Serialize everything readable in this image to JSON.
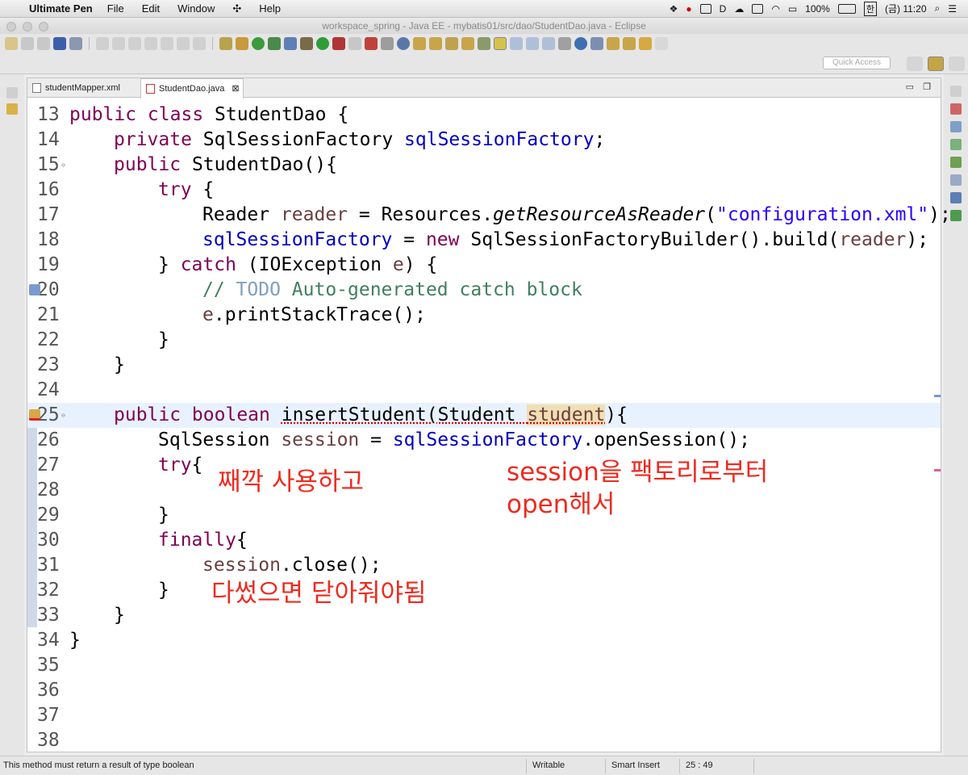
{
  "menubar": {
    "app_name": "Ultimate Pen",
    "items": [
      "File",
      "Edit",
      "Window",
      "Help"
    ],
    "battery": "100%",
    "input_method": "한",
    "clock": "(금) 11:20"
  },
  "window": {
    "title": "workspace_spring - Java EE - mybatis01/src/dao/StudentDao.java - Eclipse"
  },
  "toolbar": {
    "quick_access_placeholder": "Quick Access"
  },
  "editor": {
    "tabs": [
      {
        "label": "studentMapper.xml",
        "active": false
      },
      {
        "label": "StudentDao.java",
        "active": true,
        "close": "⊠"
      }
    ],
    "highlighted_line": "25",
    "lines": [
      {
        "n": "13",
        "marker": ""
      },
      {
        "n": "14",
        "marker": ""
      },
      {
        "n": "15",
        "marker": "fold"
      },
      {
        "n": "16",
        "marker": ""
      },
      {
        "n": "17",
        "marker": ""
      },
      {
        "n": "18",
        "marker": ""
      },
      {
        "n": "19",
        "marker": ""
      },
      {
        "n": "20",
        "marker": "task"
      },
      {
        "n": "21",
        "marker": ""
      },
      {
        "n": "22",
        "marker": ""
      },
      {
        "n": "23",
        "marker": ""
      },
      {
        "n": "24",
        "marker": ""
      },
      {
        "n": "25",
        "marker": "error"
      },
      {
        "n": "26",
        "marker": ""
      },
      {
        "n": "27",
        "marker": ""
      },
      {
        "n": "28",
        "marker": ""
      },
      {
        "n": "29",
        "marker": ""
      },
      {
        "n": "30",
        "marker": ""
      },
      {
        "n": "31",
        "marker": ""
      },
      {
        "n": "32",
        "marker": ""
      },
      {
        "n": "33",
        "marker": ""
      },
      {
        "n": "34",
        "marker": ""
      },
      {
        "n": "35",
        "marker": ""
      },
      {
        "n": "36",
        "marker": ""
      },
      {
        "n": "37",
        "marker": ""
      },
      {
        "n": "38",
        "marker": ""
      }
    ],
    "code": {
      "l13": {
        "a": "public class ",
        "b": "StudentDao {"
      },
      "l14": {
        "a": "private ",
        "b": "SqlSessionFactory ",
        "c": "sqlSessionFactory",
        "d": ";"
      },
      "l15": {
        "a": "public ",
        "b": "StudentDao(){"
      },
      "l16": {
        "a": "try",
        "b": " {"
      },
      "l17": {
        "a": "Reader ",
        "b": "reader",
        "c": " = Resources.",
        "d": "getResourceAsReader",
        "e": "(",
        "f": "\"configuration.xml\"",
        "g": ");"
      },
      "l18": {
        "a": "sqlSessionFactory",
        "b": " = ",
        "c": "new",
        "d": " SqlSessionFactoryBuilder().build(",
        "e": "reader",
        "f": ");"
      },
      "l19": {
        "a": "} ",
        "b": "catch",
        "c": " (IOException ",
        "d": "e",
        "e": ") {"
      },
      "l20": {
        "a": "// ",
        "b": "TODO",
        "c": " Auto-generated catch block"
      },
      "l21": {
        "a": "e",
        "b": ".printStackTrace();"
      },
      "l22": {
        "a": "}"
      },
      "l23": {
        "a": "}"
      },
      "l25": {
        "a": "public boolean ",
        "b": "insertStudent",
        "c": "(Student ",
        "d": "student",
        "e": "){"
      },
      "l26": {
        "a": "SqlSession ",
        "b": "session",
        "c": " = ",
        "d": "sqlSessionFactory",
        "e": ".openSession();"
      },
      "l27": {
        "a": "try",
        "b": "{"
      },
      "l29": {
        "a": "}"
      },
      "l30": {
        "a": "finally",
        "b": "{"
      },
      "l31": {
        "a": "session",
        "b": ".close();"
      },
      "l32": {
        "a": "}"
      },
      "l33": {
        "a": "}"
      },
      "l34": {
        "a": "}"
      }
    },
    "notes": {
      "note1": "째깍 사용하고",
      "note2a": "session을 팩토리로부터",
      "note2b": "open해서",
      "note3": "다썼으면 닫아줘야됨"
    }
  },
  "status": {
    "message": "This method must return a result of type boolean",
    "writable": "Writable",
    "insert_mode": "Smart Insert",
    "position": "25 : 49"
  },
  "colors": {
    "keyword": "#7f0055",
    "field": "#0000c0",
    "string": "#2a00ff",
    "comment": "#3f7f5f",
    "annotation_red": "#ee2a1f",
    "current_line": "#e8f2fe"
  }
}
